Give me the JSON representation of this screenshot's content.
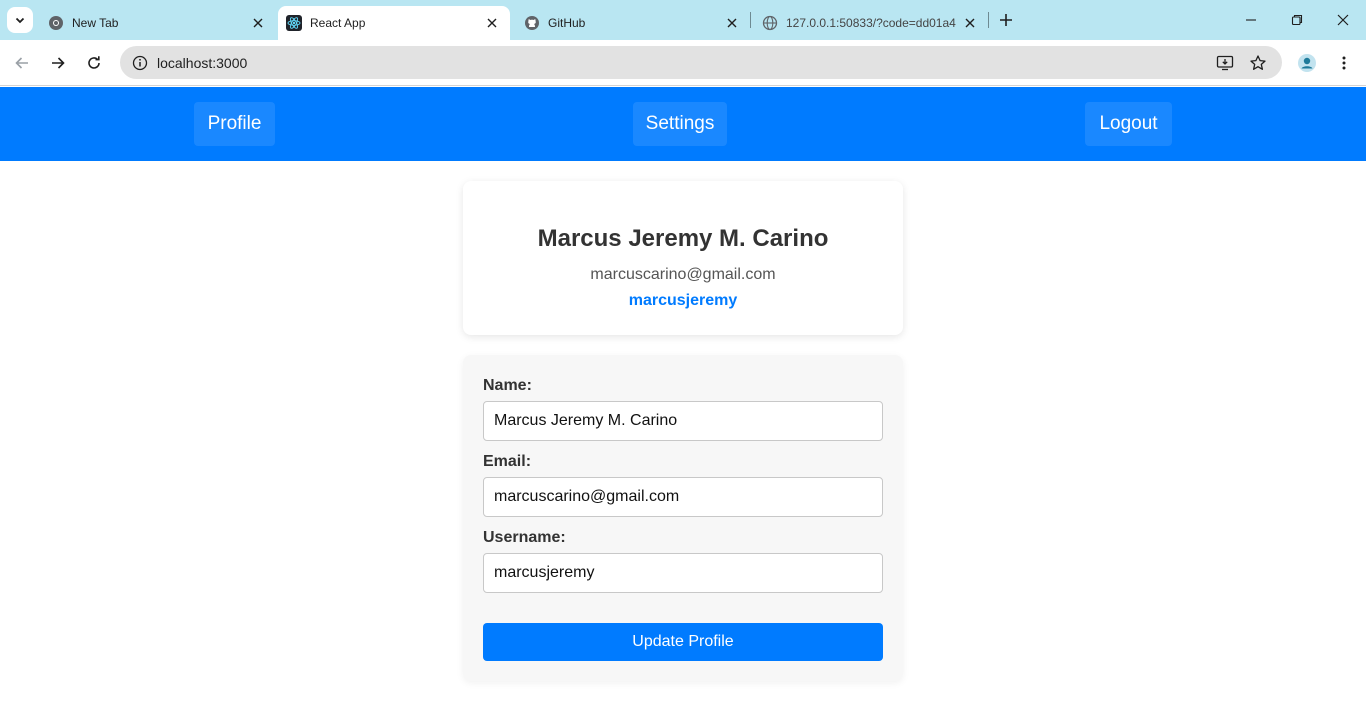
{
  "browser": {
    "tabs": [
      {
        "title": "New Tab",
        "icon": "chrome-icon",
        "active": false
      },
      {
        "title": "React App",
        "icon": "react-icon",
        "active": true
      },
      {
        "title": "GitHub",
        "icon": "github-icon",
        "active": false
      },
      {
        "title": "127.0.0.1:50833/?code=dd01a4",
        "icon": "globe-icon",
        "active": false
      }
    ],
    "url": "localhost:3000"
  },
  "navbar": {
    "profile_label": "Profile",
    "settings_label": "Settings",
    "logout_label": "Logout",
    "color": "#007bff"
  },
  "profile_card": {
    "name": "Marcus Jeremy M. Carino",
    "email": "marcuscarino@gmail.com",
    "username": "marcusjeremy"
  },
  "form": {
    "name_label": "Name:",
    "name_value": "Marcus Jeremy M. Carino",
    "email_label": "Email:",
    "email_value": "marcuscarino@gmail.com",
    "username_label": "Username:",
    "username_value": "marcusjeremy",
    "submit_label": "Update Profile"
  }
}
